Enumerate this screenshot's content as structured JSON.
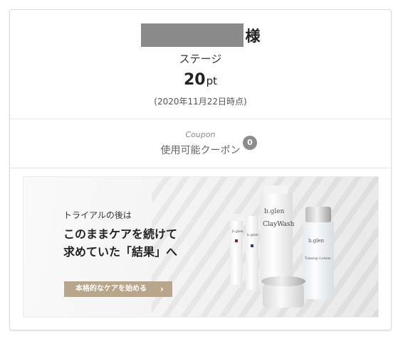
{
  "user": {
    "honorific": "様",
    "stage_label": "ステージ",
    "points_value": "20",
    "points_unit": "pt",
    "as_of": "(2020年11月22日時点)"
  },
  "coupon": {
    "label_en": "Coupon",
    "label": "使用可能クーポン",
    "count": "0"
  },
  "banner": {
    "subtitle": "トライアルの後は",
    "headline_line1": "このままケアを続けて",
    "headline_line2": "求めていた「結果」へ",
    "cta_label": "本格的なケアを始める",
    "cta_icon": "chevron-right-icon",
    "cta_color": "#b9a58a",
    "products": {
      "brand": "b.glen",
      "big_tube_name": "ClayWash",
      "bottle_name": "Toneup Lotion"
    }
  }
}
